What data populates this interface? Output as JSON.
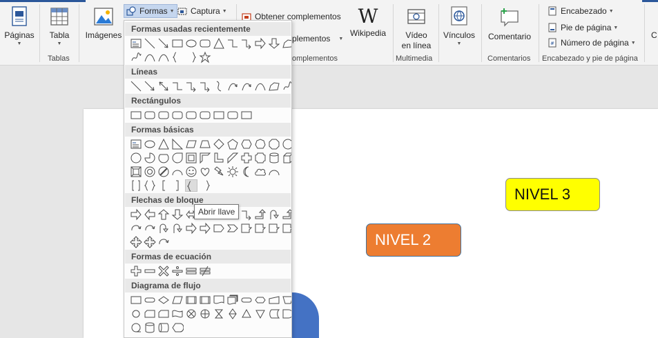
{
  "ribbon": {
    "paginas": "Páginas",
    "tabla": "Tabla",
    "tablas_group": "Tablas",
    "imagenes": "Imágenes",
    "formas": "Formas",
    "captura": "Captura",
    "obtener_complementos": "Obtener complementos",
    "mis_complementos_partial": "plementos",
    "complementos_group_partial": "omplementos",
    "wikipedia": "Wikipedia",
    "video_line1": "Vídeo",
    "video_line2": "en línea",
    "multimedia_group": "Multimedia",
    "vinculos": "Vínculos",
    "comentario": "Comentario",
    "comentarios_group": "Comentarios",
    "encabezado": "Encabezado",
    "pie_de_pagina": "Pie de página",
    "numero_de_pagina": "Número de página",
    "encabezado_group": "Encabezado y pie de página",
    "cut_off_label": "C"
  },
  "dropdown": {
    "categories": [
      "Formas usadas recientemente",
      "Líneas",
      "Rectángulos",
      "Formas básicas",
      "Flechas de bloque",
      "Formas de ecuación",
      "Diagrama de flujo"
    ],
    "tooltip": "Abrir llave"
  },
  "document": {
    "nivel3": "NIVEL 3",
    "nivel2": "NIVEL 2"
  },
  "colors": {
    "accent": "#2b579a",
    "nivel3_fill": "#ffff00",
    "nivel2_fill": "#ed7d31",
    "blue_shape": "#4472c4"
  }
}
